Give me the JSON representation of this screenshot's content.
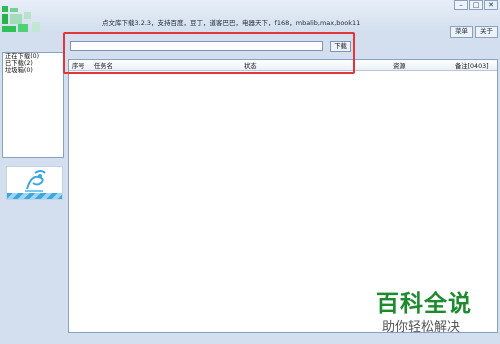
{
  "window": {
    "title": "点文库下载3.2.3，支持百度，豆丁，道客巴巴，电器天下，f168，mbalib,max,book11",
    "minimize_glyph": "–",
    "restore_glyph": "□",
    "close_glyph": "✕"
  },
  "menu": {
    "menu_label": "菜单",
    "about_label": "关于"
  },
  "sidebar": {
    "items": [
      {
        "label": "正在下载(0)"
      },
      {
        "label": "已下载(2)"
      },
      {
        "label": "垃圾箱(0)"
      }
    ]
  },
  "search": {
    "value": "",
    "placeholder": "",
    "download_label": "下载"
  },
  "table": {
    "columns": [
      "序号",
      "任务名",
      "状态",
      "资源",
      "备注[0403]"
    ]
  },
  "watermark": {
    "line1": "百科全说",
    "line2": "助你轻松解决"
  },
  "colors": {
    "highlight": "#e3343a",
    "logo_green": "#28b34a",
    "watermark_green": "#1c8b2d"
  }
}
